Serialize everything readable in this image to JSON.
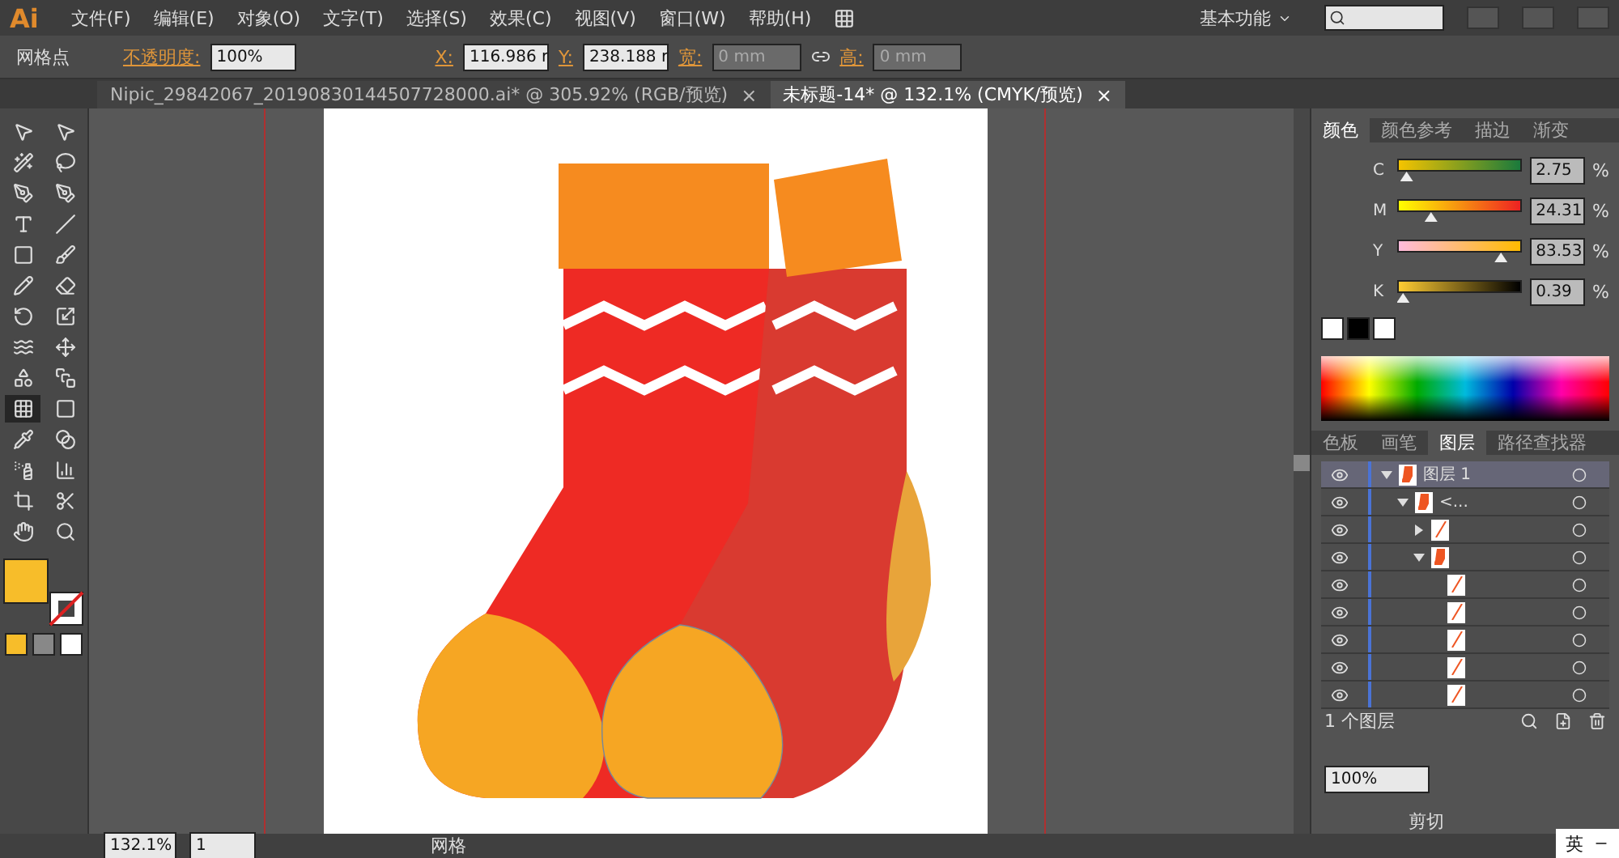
{
  "app": {
    "logo": "Ai"
  },
  "menu": [
    "文件(F)",
    "编辑(E)",
    "对象(O)",
    "文字(T)",
    "选择(S)",
    "效果(C)",
    "视图(V)",
    "窗口(W)",
    "帮助(H)"
  ],
  "workspace": {
    "label": "基本功能"
  },
  "control_bar": {
    "tool_label": "网格点",
    "opacity_label": "不透明度:",
    "opacity": "100%",
    "x_label": "X:",
    "x": "116.986 r",
    "y_label": "Y:",
    "y": "238.188 r",
    "w_label": "宽:",
    "w": "0 mm",
    "h_label": "高:",
    "h": "0 mm"
  },
  "documents": [
    {
      "title": "Nipic_29842067_20190830144507728000.ai* @ 305.92% (RGB/预览)",
      "close": "×",
      "selected": false
    },
    {
      "title": "未标题-14* @ 132.1% (CMYK/预览)",
      "close": "×",
      "selected": true
    }
  ],
  "tools": [
    {
      "kind": "select",
      "selected": false
    },
    {
      "kind": "direct",
      "selected": false
    },
    {
      "kind": "wand",
      "selected": false
    },
    {
      "kind": "lasso",
      "selected": false
    },
    {
      "kind": "pen",
      "selected": false
    },
    {
      "kind": "curve",
      "selected": false
    },
    {
      "kind": "type",
      "selected": false
    },
    {
      "kind": "line",
      "selected": false
    },
    {
      "kind": "rect",
      "selected": false
    },
    {
      "kind": "brush",
      "selected": false
    },
    {
      "kind": "pencil",
      "selected": false
    },
    {
      "kind": "eraser",
      "selected": false
    },
    {
      "kind": "rotate",
      "selected": false
    },
    {
      "kind": "scale",
      "selected": false
    },
    {
      "kind": "warp",
      "selected": false
    },
    {
      "kind": "transform",
      "selected": false
    },
    {
      "kind": "shape",
      "selected": false
    },
    {
      "kind": "perspective",
      "selected": false
    },
    {
      "kind": "mesh",
      "selected": true
    },
    {
      "kind": "gradient",
      "selected": false
    },
    {
      "kind": "eyedropper",
      "selected": false
    },
    {
      "kind": "blend",
      "selected": false
    },
    {
      "kind": "spray",
      "selected": false
    },
    {
      "kind": "graph",
      "selected": false
    },
    {
      "kind": "artboard",
      "selected": false
    },
    {
      "kind": "slice",
      "selected": false
    },
    {
      "kind": "hand",
      "selected": false
    },
    {
      "kind": "zoom",
      "selected": false
    }
  ],
  "color_panel": {
    "tabs": [
      {
        "label": "颜色",
        "selected": true
      },
      {
        "label": "颜色参考",
        "selected": false
      },
      {
        "label": "描边",
        "selected": false
      },
      {
        "label": "渐变",
        "selected": false
      }
    ],
    "channels": [
      {
        "name": "C",
        "level": 0.03,
        "value": "2.75",
        "unit": "%"
      },
      {
        "name": "M",
        "level": 0.24,
        "value": "24.31",
        "unit": "%"
      },
      {
        "name": "Y",
        "level": 0.84,
        "value": "83.53",
        "unit": "%"
      },
      {
        "name": "K",
        "level": 0.0,
        "value": "0.39",
        "unit": "%"
      }
    ]
  },
  "layers_panel": {
    "tabs": [
      {
        "label": "色板",
        "selected": false
      },
      {
        "label": "画笔",
        "selected": false
      },
      {
        "label": "图层",
        "selected": true
      },
      {
        "label": "路径查找器",
        "selected": false
      }
    ],
    "layers": [
      {
        "name": "图层 1",
        "expanded": true,
        "selected": true,
        "children": [
          {
            "name": "<...",
            "expanded": true,
            "selected": false,
            "children": [
              {
                "expanded": false,
                "selected": false
              },
              {
                "expanded": true,
                "selected": false,
                "children": [
                  {
                    "selected": false
                  },
                  {
                    "selected": false
                  },
                  {
                    "selected": false
                  },
                  {
                    "selected": false
                  },
                  {
                    "selected": false
                  }
                ]
              }
            ]
          }
        ]
      }
    ],
    "count": "1 个图层"
  },
  "transparency_panel": {
    "opacity": "100%",
    "clip": "剪切"
  },
  "status_bar": {
    "zoom": "132.1%",
    "page": "1",
    "tool": "网格"
  },
  "ime": {
    "mode": "英"
  }
}
